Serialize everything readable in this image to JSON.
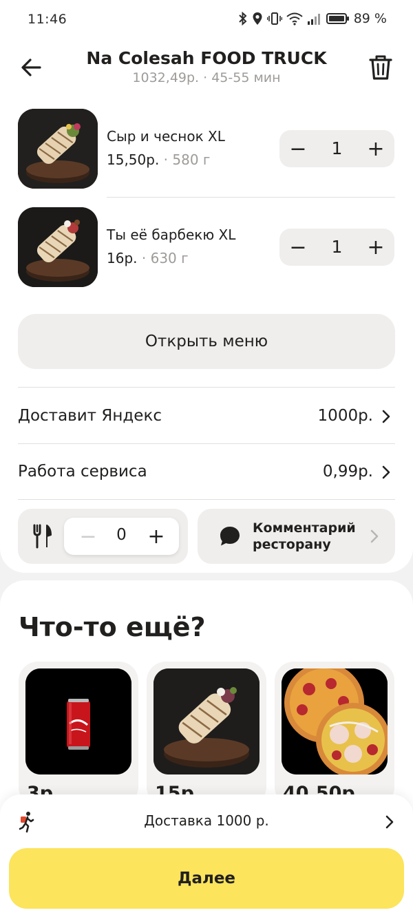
{
  "status_bar": {
    "time": "11:46",
    "battery": "89 %"
  },
  "header": {
    "title": "Na Colesah FOOD TRUCK",
    "subtitle": "1032,49р. · 45-55 мин"
  },
  "cart_items": [
    {
      "name": "Сыр и чеснок XL",
      "price": "15,50р.",
      "weight": "· 580 г",
      "qty": "1",
      "minus": "−",
      "plus": "+"
    },
    {
      "name": "Ты её барбекю XL",
      "price": "16р.",
      "weight": "· 630 г",
      "qty": "1",
      "minus": "−",
      "plus": "+"
    }
  ],
  "open_menu_label": "Открыть меню",
  "summary_rows": [
    {
      "label": "Доставит Яндекс",
      "value": "1000р."
    },
    {
      "label": "Работа сервиса",
      "value": "0,99р."
    }
  ],
  "cutlery": {
    "qty": "0",
    "minus": "−",
    "plus": "+"
  },
  "comment_label": "Комментарий ресторану",
  "recommendations": {
    "title": "Что-то ещё?",
    "items": [
      {
        "price": "3р.",
        "image": "cola-can"
      },
      {
        "price": "15р.",
        "image": "shawarma"
      },
      {
        "price": "40,50р.",
        "image": "pizza"
      }
    ]
  },
  "bottom_sheet": {
    "delivery_text": "Доставка 1000 р.",
    "next_label": "Далее"
  },
  "colors": {
    "accent_yellow": "#fce45c",
    "surface_gray": "#efeeec",
    "text_primary": "#21201f",
    "text_secondary": "#9e9b98"
  },
  "icons": [
    "back-arrow-icon",
    "trash-icon",
    "cutlery-icon",
    "comment-bubble-icon",
    "chevron-right-icon",
    "courier-icon"
  ]
}
